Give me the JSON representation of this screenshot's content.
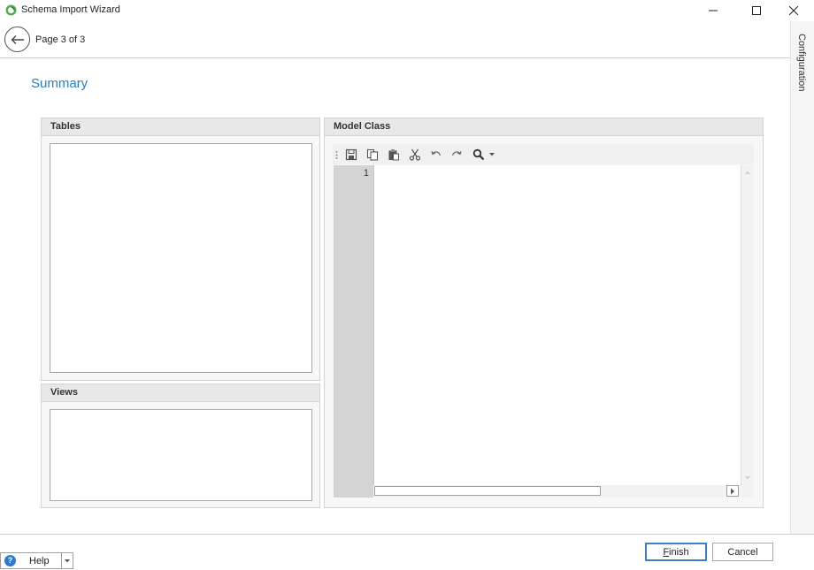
{
  "window": {
    "title": "Schema Import Wizard",
    "minimize_icon": "minimize-icon",
    "maximize_icon": "maximize-icon",
    "close_icon": "close-icon"
  },
  "header": {
    "page_label": "Page 3 of 3",
    "back_icon": "arrow-left-icon"
  },
  "side_panel": {
    "label": "Configuration"
  },
  "section_title": "Summary",
  "tables_group": {
    "title": "Tables"
  },
  "views_group": {
    "title": "Views"
  },
  "model_group": {
    "title": "Model Class",
    "toolbar": [
      "save-icon",
      "copy-icon",
      "paste-icon",
      "cut-icon",
      "undo-icon",
      "redo-icon",
      "search-icon",
      "dropdown-arrow-icon"
    ],
    "line_numbers": [
      "1"
    ]
  },
  "footer": {
    "help_label": "Help",
    "finish_label": "Finish",
    "cancel_label": "Cancel"
  },
  "colors": {
    "accent": "#2c7dc0",
    "primary_button_border": "#3c7fc4",
    "help_icon": "#2a7ad2",
    "gutter": "#d4d4d4"
  }
}
